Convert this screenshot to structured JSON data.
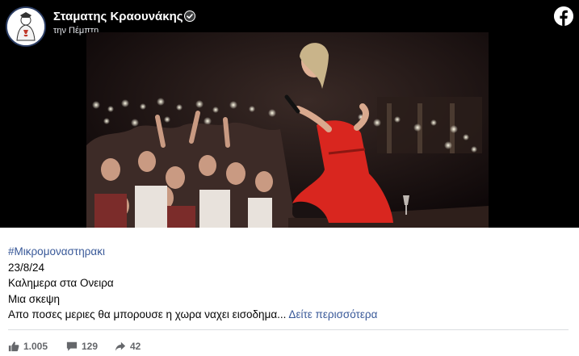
{
  "post": {
    "author": "Σταματης Κραουνάκης",
    "timestamp": "την Πέμπτη",
    "icons": {
      "avatar": "profile-avatar",
      "verified": "verified-badge-icon",
      "platform": "facebook-logo-icon"
    }
  },
  "caption": {
    "hashtag": "#Μικρομοναστηρακι",
    "date": "23/8/24",
    "line1": "Καλημερα στα Ονειρα",
    "line2": "Μια σκεψη",
    "line3": "Απο ποσες μεριες θα μπορουσε η χωρα ναχει εισοδημα...",
    "see_more": "Δείτε περισσότερα"
  },
  "stats": {
    "likes": "1.005",
    "comments": "129",
    "shares": "42"
  },
  "colors": {
    "link": "#385898",
    "header_bg": "#000000",
    "text": "#050505",
    "muted": "#65676b",
    "dress": "#d9261f"
  }
}
